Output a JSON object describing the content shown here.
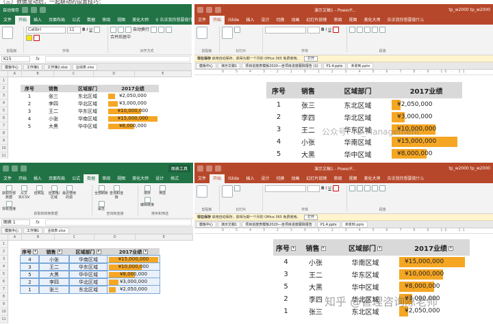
{
  "caption": "（三）数据变动后，一起联动的设置技巧：",
  "excel_top": {
    "qa_text": "自动保存",
    "tabs": [
      "文件",
      "开始",
      "插入",
      "页面布局",
      "公式",
      "数据",
      "审阅",
      "视图",
      "美化大师",
      "♀ 告诉我你想要做什么"
    ],
    "font_name": "Calibri",
    "font_size": "11",
    "group_labels": [
      "剪贴板",
      "字体",
      "对齐方式"
    ],
    "ribbon_items": [
      "自动换行",
      "合并后居中"
    ],
    "name_box": "K15",
    "fx": "fx",
    "file_tabs": [
      "模板中心",
      "工作簿1",
      "工作簿2.xlsx",
      "业绩表.xlsx"
    ],
    "col_headers": [
      "A",
      "B",
      "C",
      "D",
      "E"
    ],
    "row_headers": [
      "1",
      "2",
      "3",
      "4",
      "5",
      "6",
      "7",
      "8",
      "9",
      "10",
      "11",
      "12"
    ]
  },
  "ppt_top": {
    "title_text": "演示文稿1 - PowerP...",
    "user_text": "tp_w2000 tp_w2000",
    "tabs": [
      "文件",
      "开始",
      "iSlide",
      "插入",
      "设计",
      "切换",
      "动画",
      "幻灯片放映",
      "审阅",
      "视图",
      "美化大师",
      "告诉我你想要做什么"
    ],
    "group_labels": [
      "剪贴板",
      "幻灯片",
      "字体",
      "段落"
    ],
    "notice_bold": "现在保存",
    "notice_text": "启用自动保存，获得为期一个月的 Office 365 免费使用。",
    "notice_button": "打开",
    "file_tabs": [
      "模板中心",
      "演示文稿1",
      "项目进度表模板2020—含项目进度跟踪报告 (1)",
      "P1.4.pptx",
      "未收到.pptx"
    ],
    "ruler": "6 · 5 · 4 · 3 · 2 · 1 · 0 · 1 · 2 · 3 · 4 · 5 · 6 · 7 · 8 · 9 · 10 · 11"
  },
  "excel_bottom": {
    "title_text": "图表工具",
    "tabs": [
      "文件",
      "开始",
      "插入",
      "页面布局",
      "公式",
      "数据",
      "审阅",
      "视图",
      "美化大师",
      "设计",
      "格式"
    ],
    "ribbon_items": [
      "获取外部数据",
      "从文本/CSV",
      "自网站",
      "自表格/区域",
      "最近使用的源",
      "现有连接",
      "全部刷新",
      "查询和连接",
      "属性",
      "编辑链接",
      "排序",
      "筛选"
    ],
    "group_labels": [
      "获取和转换数据",
      "查询和连接",
      "排序和筛选"
    ],
    "name_box": "图表 1",
    "fx": "fx",
    "file_tabs": [
      "模板中心",
      "工作簿1",
      "业绩表.xlsx"
    ],
    "col_headers": [
      "A",
      "B",
      "C",
      "D",
      "E"
    ],
    "row_headers": [
      "1",
      "2",
      "3",
      "4",
      "5",
      "6",
      "7",
      "8",
      "9",
      "10",
      "11"
    ]
  },
  "ppt_bottom": {
    "title_text": "演示文稿1 - PowerP...",
    "user_text": "tp_w2000 tp_w2000",
    "tabs": [
      "文件",
      "开始",
      "iSlide",
      "插入",
      "设计",
      "切换",
      "动画",
      "幻灯片放映",
      "审阅",
      "视图",
      "美化大师",
      "告诉我你想要做什么"
    ],
    "group_labels": [
      "剪贴板",
      "幻灯片",
      "字体",
      "段落"
    ],
    "notice_bold": "现在保存",
    "notice_text": "启用自动保存，获得为期一个月的 Office 365 免费使用。",
    "notice_button": "打开",
    "file_tabs": [
      "模板中心",
      "演示文稿1",
      "项目进度表模板2020—含项目进度跟踪报告",
      "P1.4.pptx",
      "未收到.pptx"
    ],
    "ruler": "6 · 5 · 4 · 3 · 2 · 1 · 0 · 1 · 2 · 3 · 4 · 5 · 6 · 7 · 8 · 9 · 10 · 11"
  },
  "table_header": [
    "序号",
    "销售",
    "区域部门",
    "2017业绩"
  ],
  "table_top": [
    {
      "no": "1",
      "name": "张三",
      "dept": "东北区域",
      "value": "¥2,050,000",
      "amount": 2050000
    },
    {
      "no": "2",
      "name": "李四",
      "dept": "华北区域",
      "value": "¥3,000,000",
      "amount": 3000000
    },
    {
      "no": "3",
      "name": "王二",
      "dept": "华东区域",
      "value": "¥10,000,000",
      "amount": 10000000
    },
    {
      "no": "4",
      "name": "小张",
      "dept": "华南区域",
      "value": "¥15,000,000",
      "amount": 15000000
    },
    {
      "no": "5",
      "name": "大黑",
      "dept": "华中区域",
      "value": "¥8,000,000",
      "amount": 8000000
    }
  ],
  "table_bottom": [
    {
      "no": "4",
      "name": "小张",
      "dept": "华南区域",
      "value": "¥15,000,000",
      "amount": 15000000
    },
    {
      "no": "3",
      "name": "王二",
      "dept": "华东区域",
      "value": "¥10,000,000",
      "amount": 10000000
    },
    {
      "no": "5",
      "name": "大黑",
      "dept": "华中区域",
      "value": "¥8,000,000",
      "amount": 8000000
    },
    {
      "no": "2",
      "name": "李四",
      "dept": "华北区域",
      "value": "¥3,000,000",
      "amount": 3000000
    },
    {
      "no": "1",
      "name": "张三",
      "dept": "东北区域",
      "value": "¥2,050,000",
      "amount": 2050000
    }
  ],
  "watermark_top": "公众号: YL_Management",
  "watermark_bottom": "知乎 @管理咨询陈老师",
  "colors": {
    "excel_green": "#217346",
    "ppt_red": "#b7472a",
    "bar_orange": "#f5a623",
    "header_gray": "#d9d9d9"
  }
}
